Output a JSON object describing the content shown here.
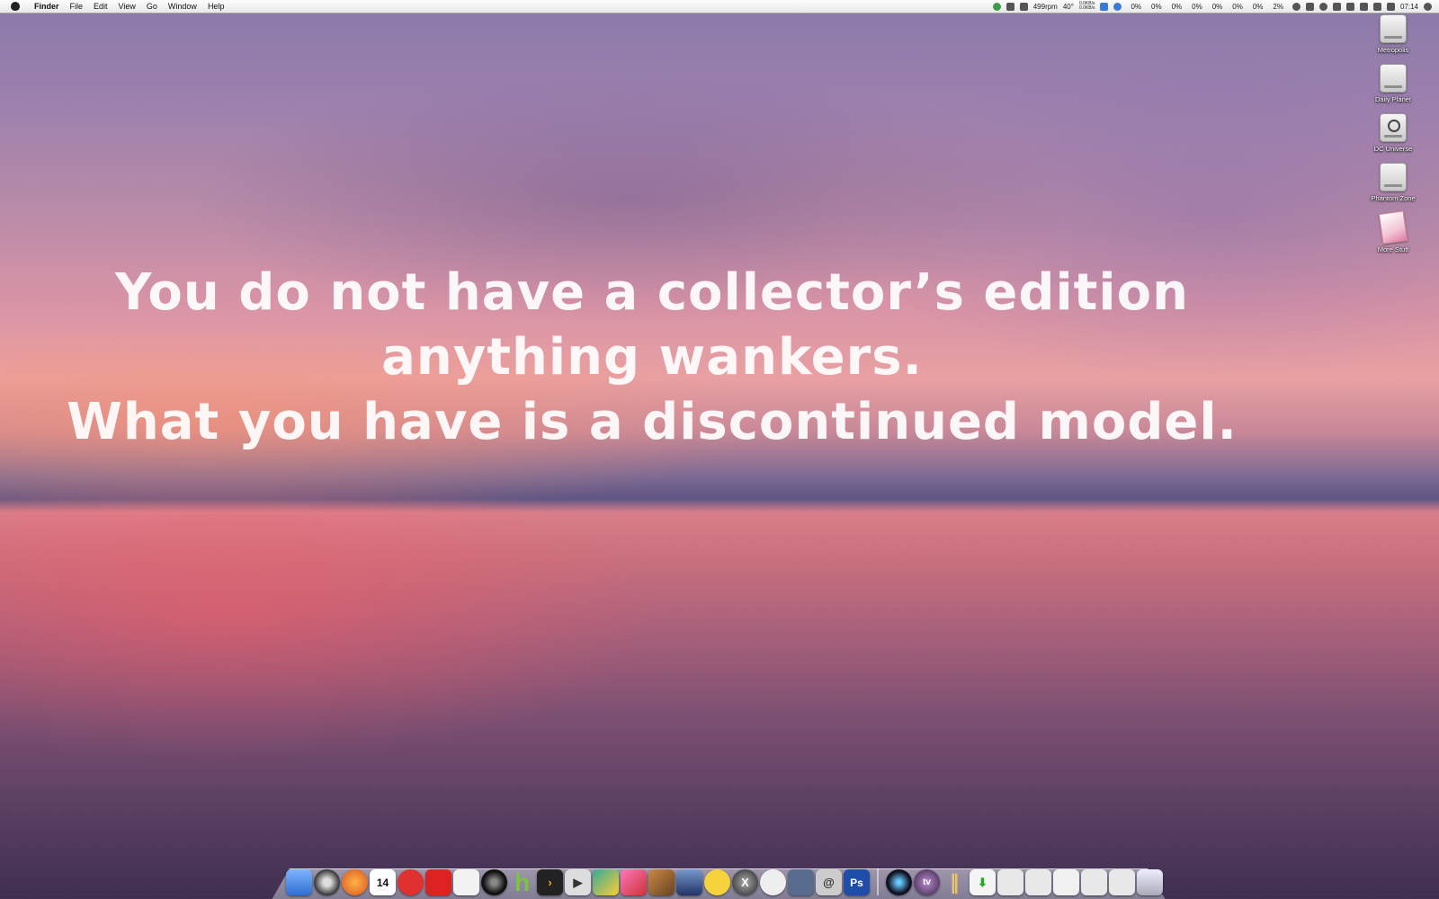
{
  "menubar": {
    "app": "Finder",
    "items": [
      "File",
      "Edit",
      "View",
      "Go",
      "Window",
      "Help"
    ],
    "status": {
      "fan": "499rpm",
      "temp": "40°",
      "net_up": "0.0KB/s",
      "net_down": "0.0KB/s",
      "cpu": [
        "0%",
        "0%",
        "0%",
        "0%",
        "0%",
        "0%",
        "0%",
        "2%"
      ],
      "clock": "07:14"
    }
  },
  "desktop_icons": [
    {
      "label": "Metropolis",
      "icon": "drive-icon"
    },
    {
      "label": "Daily Planet",
      "icon": "drive-icon"
    },
    {
      "label": "DC Universe",
      "icon": "time-machine-icon"
    },
    {
      "label": "Phantom Zone",
      "icon": "drive-icon"
    },
    {
      "label": "More Stuff",
      "icon": "stack-icon"
    }
  ],
  "quote": {
    "line1": "You do not have a collector’s edition",
    "line2": "anything wankers.",
    "line3": "What you have is a discontinued model."
  },
  "dock": {
    "calendar_day": "14",
    "photoshop_label": "Ps",
    "hulu_label": "h",
    "tv_label": "tv"
  },
  "colors": {
    "finder_blue": "#3f7fd0",
    "photoshop_blue": "#1f4ea8",
    "hulu_green": "#7cc243"
  }
}
